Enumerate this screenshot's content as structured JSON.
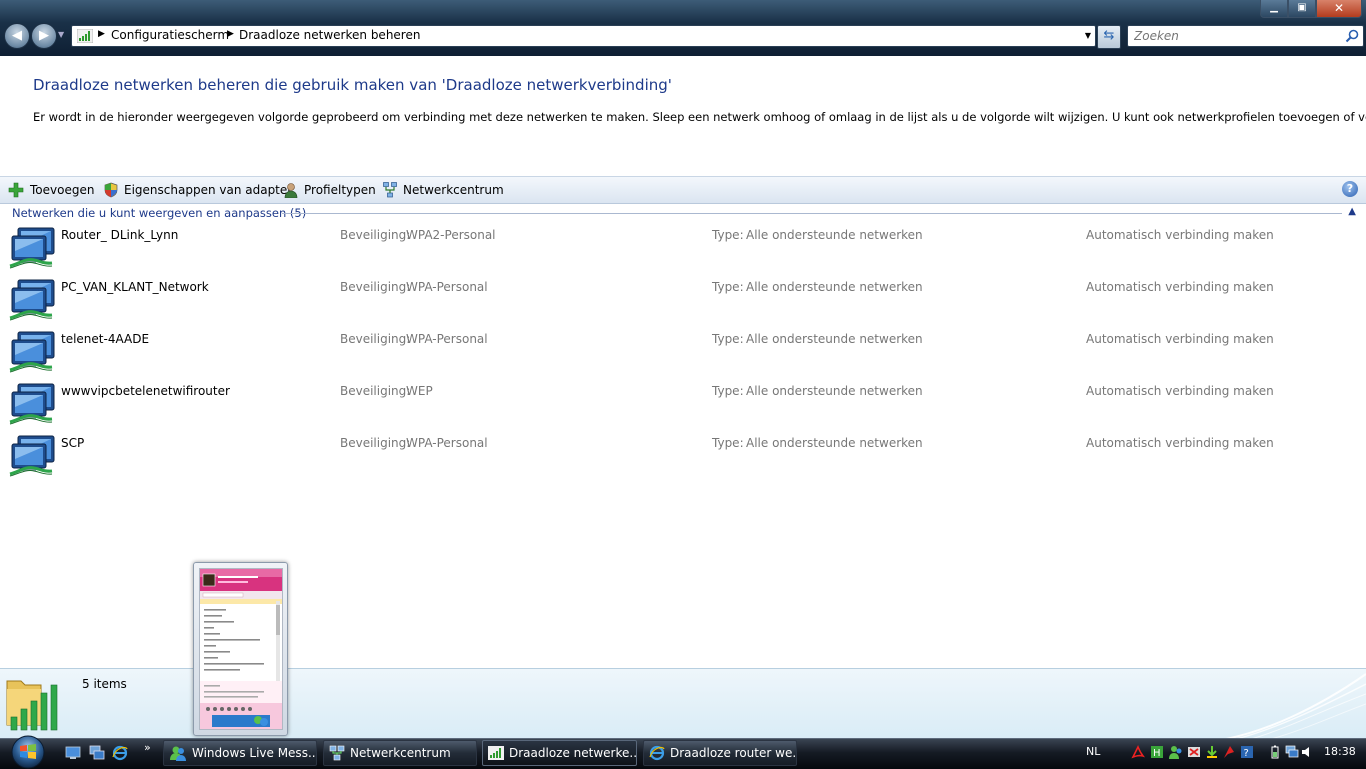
{
  "window": {
    "minimize_icon": "minimize-icon",
    "maximize_icon": "maximize-icon",
    "close_icon": "close-icon"
  },
  "address_bar": {
    "breadcrumbs": [
      "Configuratiescherm",
      "Draadloze netwerken beheren"
    ],
    "search_placeholder": "Zoeken"
  },
  "header": {
    "title": "Draadloze netwerken beheren die gebruik maken van 'Draadloze netwerkverbinding'",
    "description": "Er wordt in de hieronder weergegeven volgorde geprobeerd om verbinding met deze netwerken te maken. Sleep een netwerk omhoog of omlaag in de lijst als u de volgorde wilt wijzigen. U kunt ook netwerkprofielen toevoegen of verwijderen."
  },
  "toolbar": {
    "add_label": "Toevoegen",
    "adapter_label": "Eigenschappen van adapter",
    "profile_types_label": "Profieltypen",
    "network_center_label": "Netwerkcentrum"
  },
  "group": {
    "header": "Netwerken die u kunt weergeven en aanpassen (5)"
  },
  "labels": {
    "security": "Beveiliging:",
    "type": "Type:"
  },
  "networks": [
    {
      "name": "Router_ DLink_Lynn",
      "security": "WPA2-Personal",
      "type": "Alle ondersteunde netwerken",
      "mode": "Automatisch verbinding maken"
    },
    {
      "name": "PC_VAN_KLANT_Network",
      "security": "WPA-Personal",
      "type": "Alle ondersteunde netwerken",
      "mode": "Automatisch verbinding maken"
    },
    {
      "name": "telenet-4AADE",
      "security": "WPA-Personal",
      "type": "Alle ondersteunde netwerken",
      "mode": "Automatisch verbinding maken"
    },
    {
      "name": "wwwvipcbetelenetwifirouter",
      "security": "WEP",
      "type": "Alle ondersteunde netwerken",
      "mode": "Automatisch verbinding maken"
    },
    {
      "name": "SCP",
      "security": "WPA-Personal",
      "type": "Alle ondersteunde netwerken",
      "mode": "Automatisch verbinding maken"
    }
  ],
  "details": {
    "count": "5 items"
  },
  "taskbar": {
    "buttons": [
      {
        "label": "Windows Live Mess...",
        "active": false
      },
      {
        "label": "Netwerkcentrum",
        "active": false
      },
      {
        "label": "Draadloze netwerke...",
        "active": true
      },
      {
        "label": "Draadloze router we...",
        "active": false
      }
    ],
    "language": "NL",
    "clock": "18:38"
  }
}
